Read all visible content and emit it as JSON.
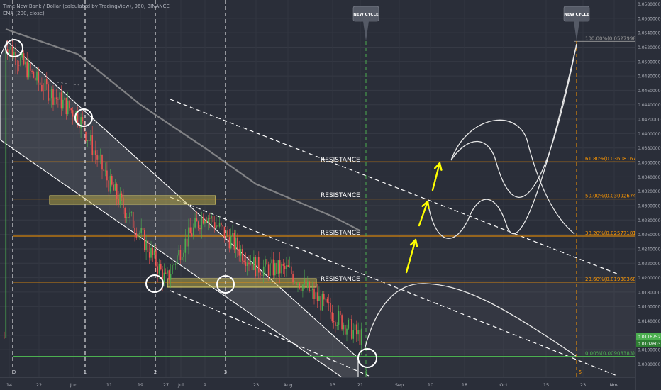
{
  "legend": {
    "symbol_line": "Time New Bank / Dollar (calculated by TradingView), 960, BINANCE",
    "ema_line": "EMA (200, close)"
  },
  "price_axis": {
    "labels": [
      "0.05800000",
      "0.05600000",
      "0.05400000",
      "0.05200000",
      "0.05000000",
      "0.04800000",
      "0.04600000",
      "0.04400000",
      "0.04200000",
      "0.04000000",
      "0.03800000",
      "0.03600000",
      "0.03400000",
      "0.03200000",
      "0.03000000",
      "0.02800000",
      "0.02600000",
      "0.02400000",
      "0.02200000",
      "0.02000000",
      "0.01800000",
      "0.01600000",
      "0.01400000",
      "0.01200000",
      "0.01000000",
      "0.00800000"
    ],
    "current_price_badge": "0.01167525",
    "ema_price_badge": "0.01026033"
  },
  "time_axis": {
    "labels": [
      "14",
      "22",
      "Jun",
      "11",
      "19",
      "27",
      "Jul",
      "9",
      "23",
      "Aug",
      "13",
      "21",
      "Sep",
      "10",
      "18",
      "Oct",
      "15",
      "23",
      "Nov"
    ]
  },
  "cycle_markers": {
    "small_counts": [
      "0",
      "1",
      "2",
      "3",
      "4",
      "5"
    ],
    "new_cycle_labels": [
      "NEW CYCLE",
      "NEW CYCLE"
    ]
  },
  "fibonacci": {
    "levels": [
      {
        "label": "100.00%(0.05279986)",
        "price": 0.05279986,
        "color": "#9e9e9e"
      },
      {
        "label": "61.80%(0.03608167)",
        "price": 0.03608167,
        "color": "#ff9800"
      },
      {
        "label": "50.00%(0.03092674)",
        "price": 0.03092674,
        "color": "#ff9800"
      },
      {
        "label": "38.20%(0.02577181)",
        "price": 0.02577181,
        "color": "#ff9800"
      },
      {
        "label": "23.60%(0.01938368)",
        "price": 0.01938368,
        "color": "#ff9800"
      },
      {
        "label": "0.00%(0.00908383)",
        "price": 0.00908383,
        "color": "#4caf50"
      }
    ]
  },
  "annotations": {
    "resistance_labels": [
      "RESISTANCE",
      "RESISTANCE",
      "RESISTANCE",
      "RESISTANCE"
    ]
  },
  "colors": {
    "background": "#2a2e39",
    "up_candle": "#4caf50",
    "down_candle": "#ef5350",
    "fib_orange": "#ff9800",
    "fib_green": "#4caf50",
    "arrow_yellow": "#ffff00",
    "zone_fill": "#c8b94a",
    "cycle_line_green": "#4caf50",
    "cycle_line_orange": "#ff9800"
  },
  "chart_data": {
    "type": "candlestick",
    "symbol": "Time New Bank / Dollar (calculated by TradingView)",
    "interval": "960",
    "exchange": "BINANCE",
    "ylim": [
      0.007,
      0.059
    ],
    "series": [
      {
        "name": "EMA (200, close)",
        "points": [
          {
            "date": "May 14",
            "y": 0.0545
          },
          {
            "date": "Jun 1",
            "y": 0.051
          },
          {
            "date": "Jun 19",
            "y": 0.044
          },
          {
            "date": "Jul 9",
            "y": 0.038
          },
          {
            "date": "Jul 23",
            "y": 0.033
          },
          {
            "date": "Aug 13",
            "y": 0.0285
          },
          {
            "date": "Aug 21",
            "y": 0.0265
          }
        ]
      },
      {
        "name": "price (approx.)",
        "points": [
          {
            "date": "May 14",
            "y": 0.0525
          },
          {
            "date": "May 22",
            "y": 0.047
          },
          {
            "date": "Jun 1",
            "y": 0.0425
          },
          {
            "date": "Jun 11",
            "y": 0.033
          },
          {
            "date": "Jun 19",
            "y": 0.026
          },
          {
            "date": "Jun 27",
            "y": 0.0195
          },
          {
            "date": "Jul 1",
            "y": 0.024
          },
          {
            "date": "Jul 9",
            "y": 0.029
          },
          {
            "date": "Jul 23",
            "y": 0.0215
          },
          {
            "date": "Aug 1",
            "y": 0.021
          },
          {
            "date": "Aug 13",
            "y": 0.015
          },
          {
            "date": "Aug 21",
            "y": 0.0117
          }
        ]
      }
    ]
  }
}
